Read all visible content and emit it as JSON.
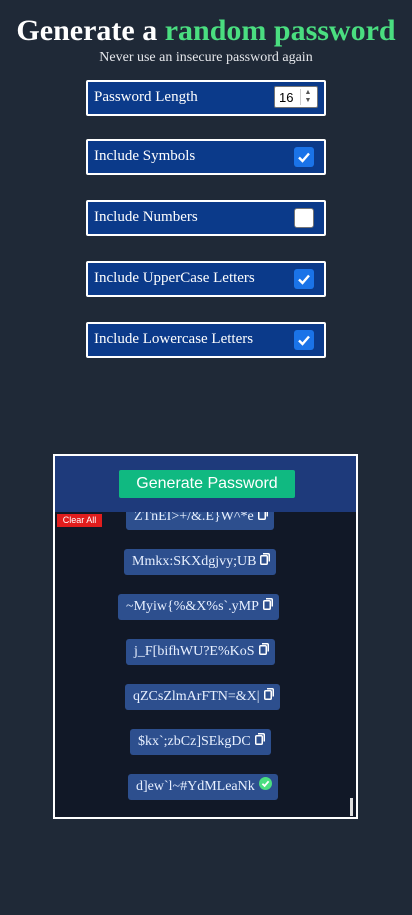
{
  "header": {
    "title_prefix": "Generate a",
    "title_accent": "random password",
    "subtitle": "Never use an insecure password again"
  },
  "options": {
    "length": {
      "label": "Password Length",
      "value": "16"
    },
    "symbols": {
      "label": "Include Symbols",
      "checked": true
    },
    "numbers": {
      "label": "Include Numbers",
      "checked": false
    },
    "uppercase": {
      "label": "Include UpperCase Letters",
      "checked": true
    },
    "lowercase": {
      "label": "Include Lowercase Letters",
      "checked": true
    }
  },
  "panel": {
    "generate_label": "Generate Password",
    "clear_label": "Clear All",
    "passwords": [
      "ZTnEI>+/&.E}W^*e",
      "Mmkx:SKXdgjvy;UB",
      "~Myiw{%&X%s`.yMP",
      "j_F[bifhWU?E%KoS",
      "qZCsZlmArFTN=&X|",
      "$kx`;zbCz]SEkgDC",
      "d]ew`l~#YdMLeaNk"
    ],
    "last_copied": true
  },
  "colors": {
    "background": "#1f2937",
    "accent": "#4ade80",
    "option_bg": "#0b3a8a",
    "generate_btn": "#10b981",
    "clear_btn": "#e11d1d"
  }
}
